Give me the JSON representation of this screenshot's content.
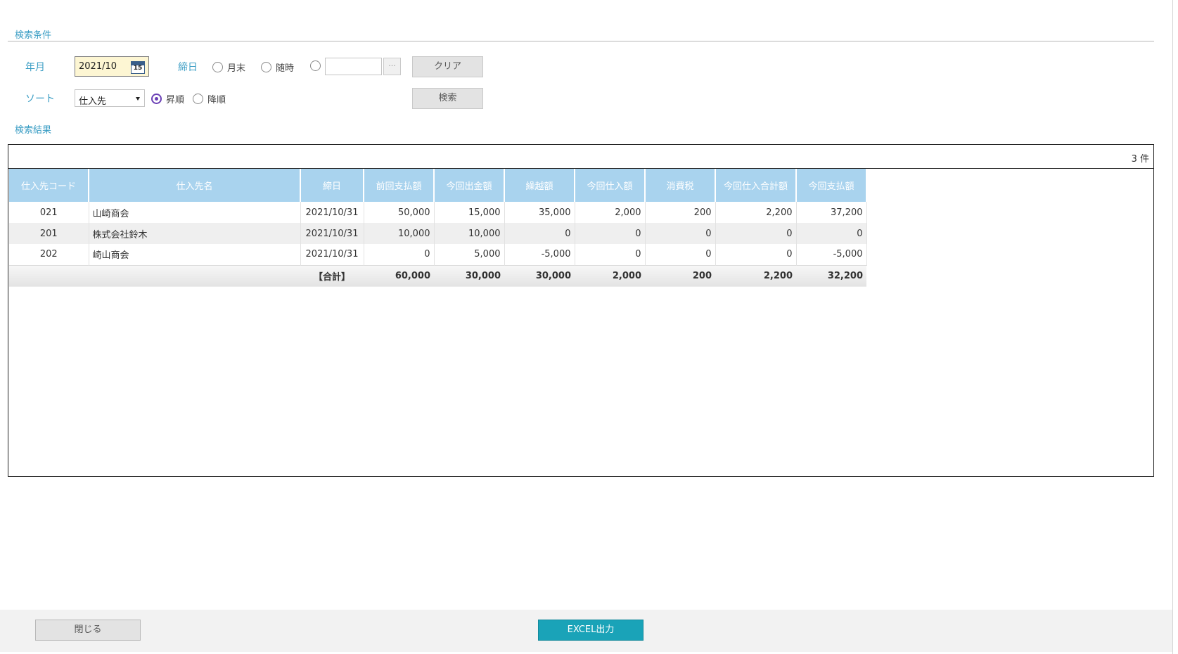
{
  "conditions": {
    "title": "検索条件",
    "year_month_label": "年月",
    "year_month_value": "2021/10",
    "calendar_icon_text": "15",
    "closing_label": "締日",
    "closing_options": [
      "月末",
      "随時",
      ""
    ],
    "more_button": "···",
    "clear_button": "クリア",
    "sort_label": "ソート",
    "sort_value": "仕入先",
    "order_options": [
      "昇順",
      "降順"
    ],
    "order_selected": "昇順",
    "search_button": "検索"
  },
  "results": {
    "title": "検索結果",
    "count": "3 件",
    "columns": [
      "仕入先コード",
      "仕入先名",
      "締日",
      "前回支払額",
      "今回出金額",
      "繰越額",
      "今回仕入額",
      "消費税",
      "今回仕入合計額",
      "今回支払額"
    ],
    "rows": [
      [
        "021",
        "山崎商会",
        "2021/10/31",
        "50,000",
        "15,000",
        "35,000",
        "2,000",
        "200",
        "2,200",
        "37,200"
      ],
      [
        "201",
        "株式会社鈴木",
        "2021/10/31",
        "10,000",
        "10,000",
        "0",
        "0",
        "0",
        "0",
        "0"
      ],
      [
        "202",
        "崎山商会",
        "2021/10/31",
        "0",
        "5,000",
        "-5,000",
        "0",
        "0",
        "0",
        "-5,000"
      ]
    ],
    "total_label": "【合計】",
    "totals": [
      "60,000",
      "30,000",
      "30,000",
      "2,000",
      "200",
      "2,200",
      "32,200"
    ]
  },
  "footer": {
    "close_button": "閉じる",
    "excel_button": "EXCEL出力"
  },
  "colors": {
    "accent": "#3a9dc4",
    "header_bg": "#a9d3ee",
    "excel_button": "#1aa3b8",
    "radio_selected": "#6a3fb5"
  }
}
